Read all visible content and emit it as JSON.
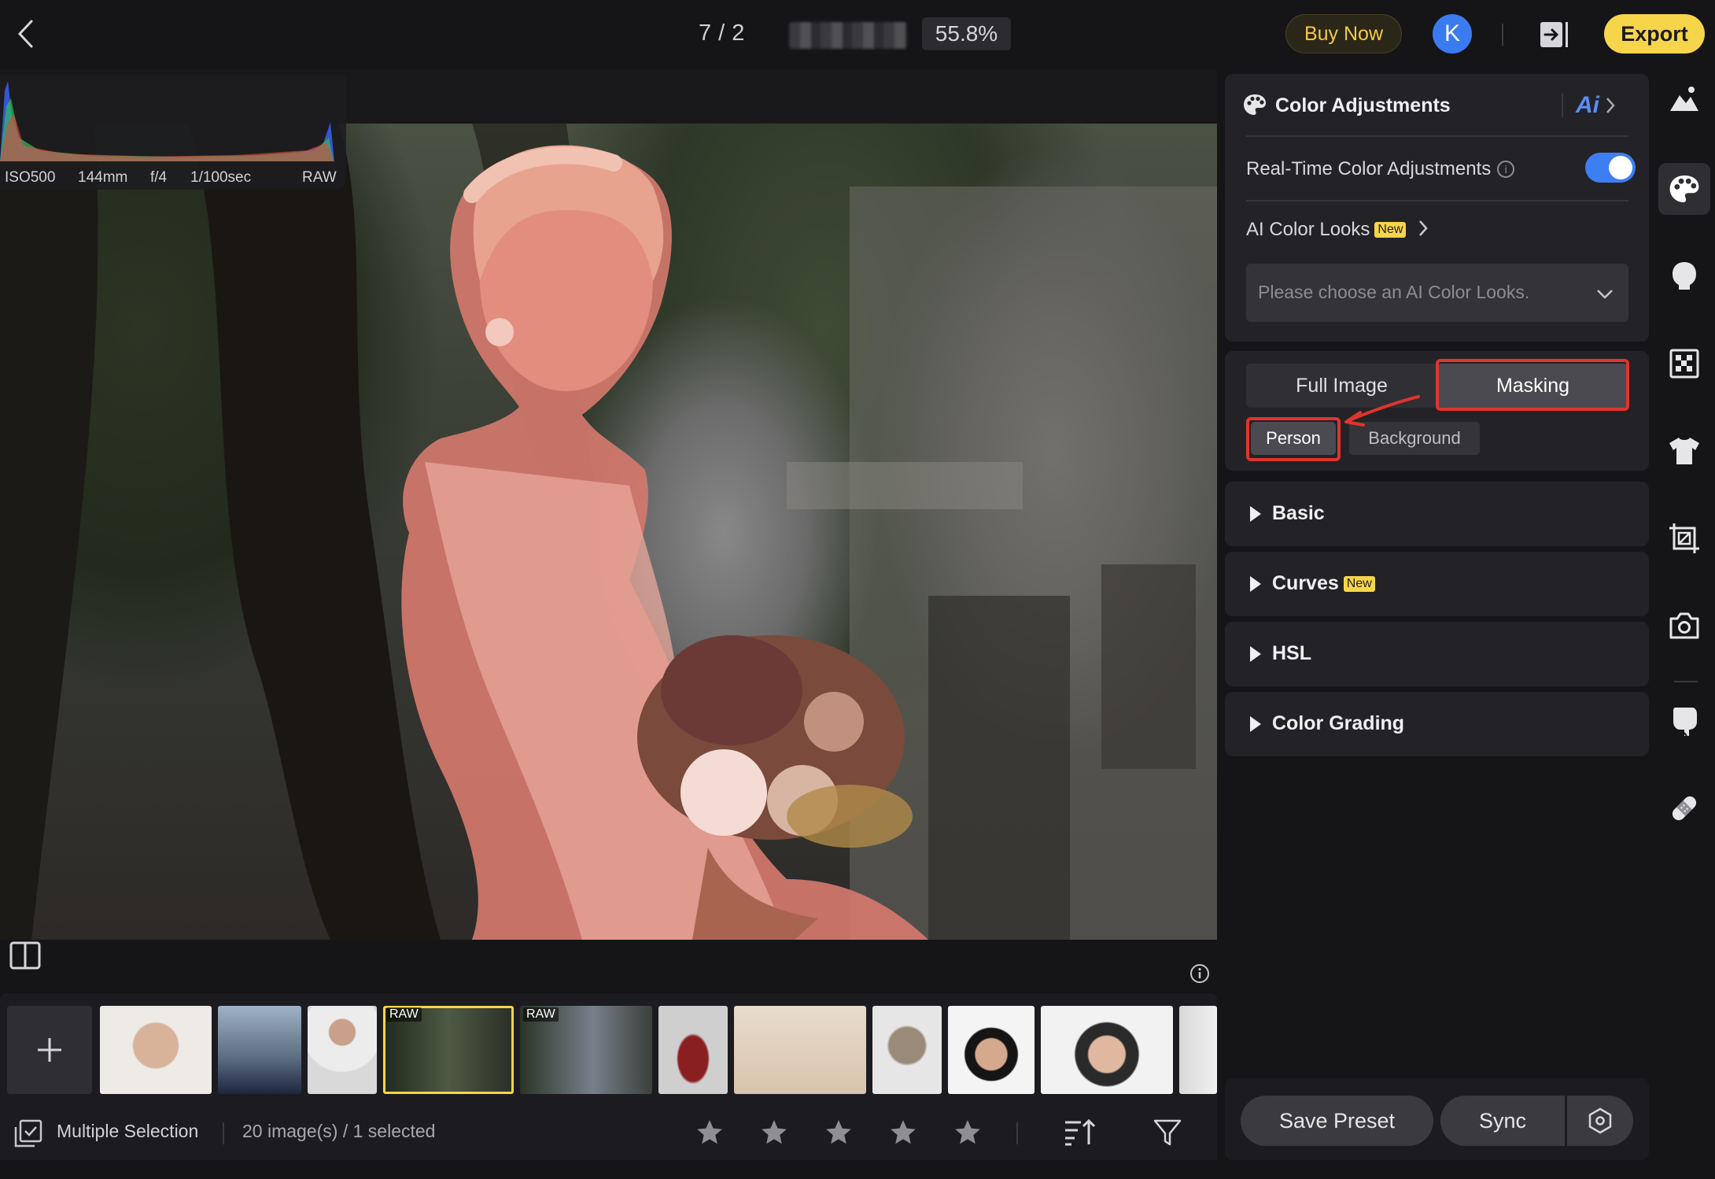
{
  "topbar": {
    "counter": "7 / 2",
    "zoom": "55.8%",
    "buy_now": "Buy Now",
    "avatar_initial": "K",
    "export": "Export"
  },
  "histogram": {
    "iso": "ISO500",
    "focal": "144mm",
    "aperture": "f/4",
    "shutter": "1/100sec",
    "format": "RAW"
  },
  "filmstrip": {
    "raw_label": "RAW",
    "thumbnails": [
      {
        "id": "thumb-1",
        "raw": false
      },
      {
        "id": "thumb-2",
        "raw": false
      },
      {
        "id": "thumb-3",
        "raw": false
      },
      {
        "id": "thumb-4",
        "raw": true,
        "selected": true
      },
      {
        "id": "thumb-5",
        "raw": true
      },
      {
        "id": "thumb-6",
        "raw": false
      },
      {
        "id": "thumb-7",
        "raw": false
      },
      {
        "id": "thumb-8",
        "raw": false
      },
      {
        "id": "thumb-9",
        "raw": false
      },
      {
        "id": "thumb-10",
        "raw": false
      },
      {
        "id": "thumb-11",
        "raw": false
      }
    ]
  },
  "bottombar": {
    "multiple_selection": "Multiple Selection",
    "count": "20 image(s) / 1 selected",
    "rating_stars": 5
  },
  "panel": {
    "title": "Color Adjustments",
    "ai_label": "Ai",
    "realtime_label": "Real-Time Color Adjustments",
    "realtime_on": true,
    "ai_color_looks": "AI Color Looks",
    "new_badge": "New",
    "looks_placeholder": "Please choose an AI Color Looks.",
    "mode_full": "Full Image",
    "mode_masking": "Masking",
    "mask_person": "Person",
    "mask_background": "Background",
    "sections": {
      "basic": "Basic",
      "curves": "Curves",
      "hsl": "HSL",
      "color_grading": "Color Grading"
    },
    "save_preset": "Save Preset",
    "sync": "Sync"
  },
  "colors": {
    "accent_yellow": "#f6d54a",
    "toggle_blue": "#3d7ff2",
    "highlight_red": "#e0342e",
    "mask_overlay": "#e86a5a"
  },
  "rail_icons": [
    "landscape-icon",
    "palette-icon",
    "face-icon",
    "pattern-icon",
    "shirt-icon",
    "crop-icon",
    "camera-icon",
    "hand-icon",
    "bandage-icon"
  ]
}
